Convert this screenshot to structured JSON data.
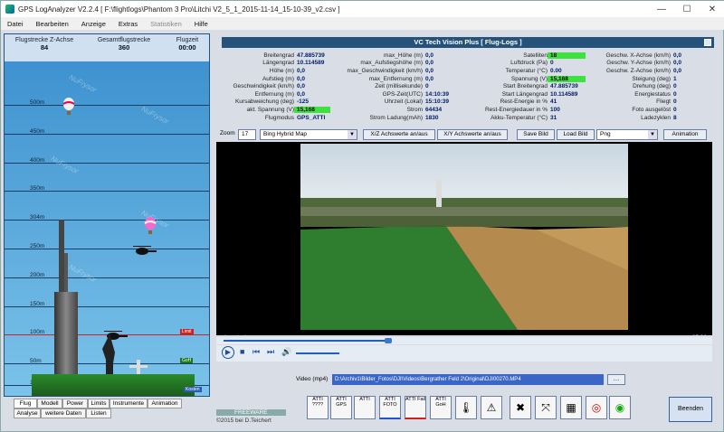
{
  "window": {
    "title": "GPS LogAnalyzer V2.2.4   [ F:\\flightlogs\\Phantom 3 Pro\\Litchi V2_5_1_2015-11-14_15-10-39_v2.csv ]"
  },
  "menu": [
    "Datei",
    "Bearbeiten",
    "Anzeige",
    "Extras",
    "Statistiken",
    "Hilfe"
  ],
  "left": {
    "header": {
      "z_label": "Flugstrecke Z-Achse",
      "z_value": "84",
      "total_label": "Gesamtflugstrecke",
      "total_value": "360",
      "time_label": "Flugzeit",
      "time_value": "00:00"
    },
    "altitude_labels": [
      "500m",
      "450m",
      "400m",
      "350m",
      "304m",
      "250m",
      "200m",
      "150m",
      "100m",
      "50m",
      "10m"
    ],
    "markers": {
      "limit": "Limit",
      "goal": "GoH",
      "ground": "Kosten"
    },
    "watermark": "NuFrysor",
    "tabs_row1": [
      "Flug",
      "Modell",
      "Power",
      "Limits",
      "Instrumente",
      "Animation"
    ],
    "tabs_row2": [
      "Analyse",
      "weitere Daten",
      "Listen"
    ]
  },
  "right": {
    "header": "VC Tech Vision Plus [ Flug-Logs ]",
    "col1": [
      {
        "label": "Breitengrad",
        "value": "47.885739"
      },
      {
        "label": "Längengrad",
        "value": "10.114589"
      },
      {
        "label": "Höhe (m)",
        "value": "0,0"
      },
      {
        "label": "Aufstieg (m)",
        "value": "0,0"
      },
      {
        "label": "Geschwindigkeit (km/h)",
        "value": "0,0"
      },
      {
        "label": "Entfernung (m)",
        "value": "0,0"
      },
      {
        "label": "Kursabweichung (deg)",
        "value": "-125"
      },
      {
        "label": "akt. Spannung (V)",
        "value": "15,168",
        "hl": true
      },
      {
        "label": "Flugmodus",
        "value": "GPS_ATTI"
      }
    ],
    "col2": [
      {
        "label": "max_Höhe (m)",
        "value": "0,0"
      },
      {
        "label": "max_Aufstiegshöhe (m)",
        "value": "0,0"
      },
      {
        "label": "max_Geschwindigkeit (km/h)",
        "value": "0,0"
      },
      {
        "label": "max_Entfernung (m)",
        "value": "0,0"
      },
      {
        "label": "Zeit (millisekunde)",
        "value": "0"
      },
      {
        "label": "GPS-Zeit(UTC)",
        "value": "14:10:39"
      },
      {
        "label": "Uhrzeit (Lokal)",
        "value": "15:10:39"
      },
      {
        "label": "Strom",
        "value": "64434"
      },
      {
        "label": "Strom Ladung(mAh)",
        "value": "1830"
      }
    ],
    "col3": [
      {
        "label": "Satelliten",
        "value": "18",
        "hl": true
      },
      {
        "label": "Luftdruck (Pa)",
        "value": "0"
      },
      {
        "label": "Temperatur (°C)",
        "value": "0.00"
      },
      {
        "label": "Spannung (V)",
        "value": "15,168",
        "hl": true
      },
      {
        "label": "Start Breitengrad",
        "value": "47.885739"
      },
      {
        "label": "Start Längengrad",
        "value": "10.114589"
      },
      {
        "label": "Rest-Energie in %",
        "value": "41"
      },
      {
        "label": "Rest-Energiedauer in %",
        "value": "100"
      },
      {
        "label": "Akku-Temperatur (°C)",
        "value": "31"
      }
    ],
    "col4": [
      {
        "label": "Geschw. X-Achse (km/h)",
        "value": "0,0"
      },
      {
        "label": "Geschw. Y-Achse (km/h)",
        "value": "0,0"
      },
      {
        "label": "Geschw. Z-Achse (km/h)",
        "value": "0,0"
      },
      {
        "label": "Steigung (deg)",
        "value": "1"
      },
      {
        "label": "Drehung (deg)",
        "value": "0"
      },
      {
        "label": "Energiestatus",
        "value": "0"
      },
      {
        "label": "Fliegt",
        "value": "0"
      },
      {
        "label": "Foto ausgelöst",
        "value": "0"
      },
      {
        "label": "Ladezyklen",
        "value": "8"
      }
    ],
    "controls": {
      "zoom_label": "Zoom",
      "zoom_value": "17",
      "map_type": "Bing Hybrid Map",
      "xz": "X/Z Achswerte an/aus",
      "xy": "X/Y Achswerte an/aus",
      "save": "Save Bild",
      "load": "Load Bild",
      "format": "Png",
      "animation": "Animation"
    },
    "video": {
      "status": "Angehalten",
      "time": "05:06",
      "label": "Video (mp4)",
      "path": "D:\\Archiv1\\Bilder_Fotos\\DJI\\Videos\\Bergrather Feld 2\\Original\\DJI00270.MP4"
    },
    "brand": "FREEWARE",
    "copyright": "©2015  bei D.Teichert",
    "toolbar": [
      "ATTI ????",
      "ATTI GPS",
      "ATTI",
      "ATTI FOTO",
      "ATTI Fail",
      "ATTI GoH",
      "",
      "",
      "",
      "",
      "",
      ""
    ],
    "end_button": "Beenden"
  }
}
